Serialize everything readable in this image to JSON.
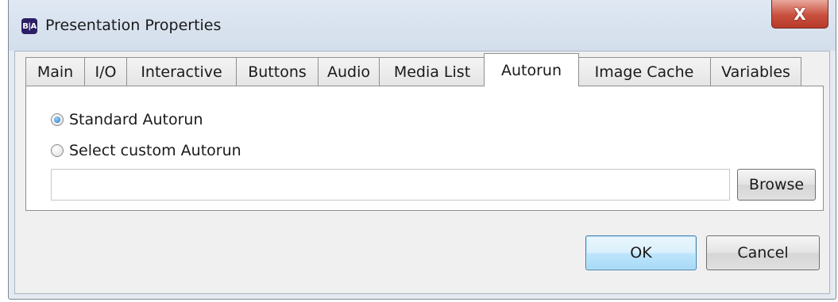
{
  "window": {
    "title": "Presentation Properties",
    "app_icon_text": "B|A",
    "close_glyph": "X"
  },
  "tabs": [
    {
      "label": "Main",
      "active": false
    },
    {
      "label": "I/O",
      "active": false
    },
    {
      "label": "Interactive",
      "active": false
    },
    {
      "label": "Buttons",
      "active": false
    },
    {
      "label": "Audio",
      "active": false
    },
    {
      "label": "Media List",
      "active": false
    },
    {
      "label": "Autorun",
      "active": true
    },
    {
      "label": "Image Cache",
      "active": false
    },
    {
      "label": "Variables",
      "active": false
    }
  ],
  "autorun": {
    "standard_label": "Standard Autorun",
    "custom_label": "Select custom Autorun",
    "selected": "standard",
    "custom_path_value": "",
    "browse_label": "Browse"
  },
  "footer": {
    "ok_label": "OK",
    "cancel_label": "Cancel"
  },
  "icons": {
    "app": "app-logo-icon",
    "close": "close-icon"
  },
  "colors": {
    "title_bar": "#d3deec",
    "close_button": "#c9503e",
    "default_button": "#bee6fd",
    "radio_selected": "#1a6fc4"
  }
}
